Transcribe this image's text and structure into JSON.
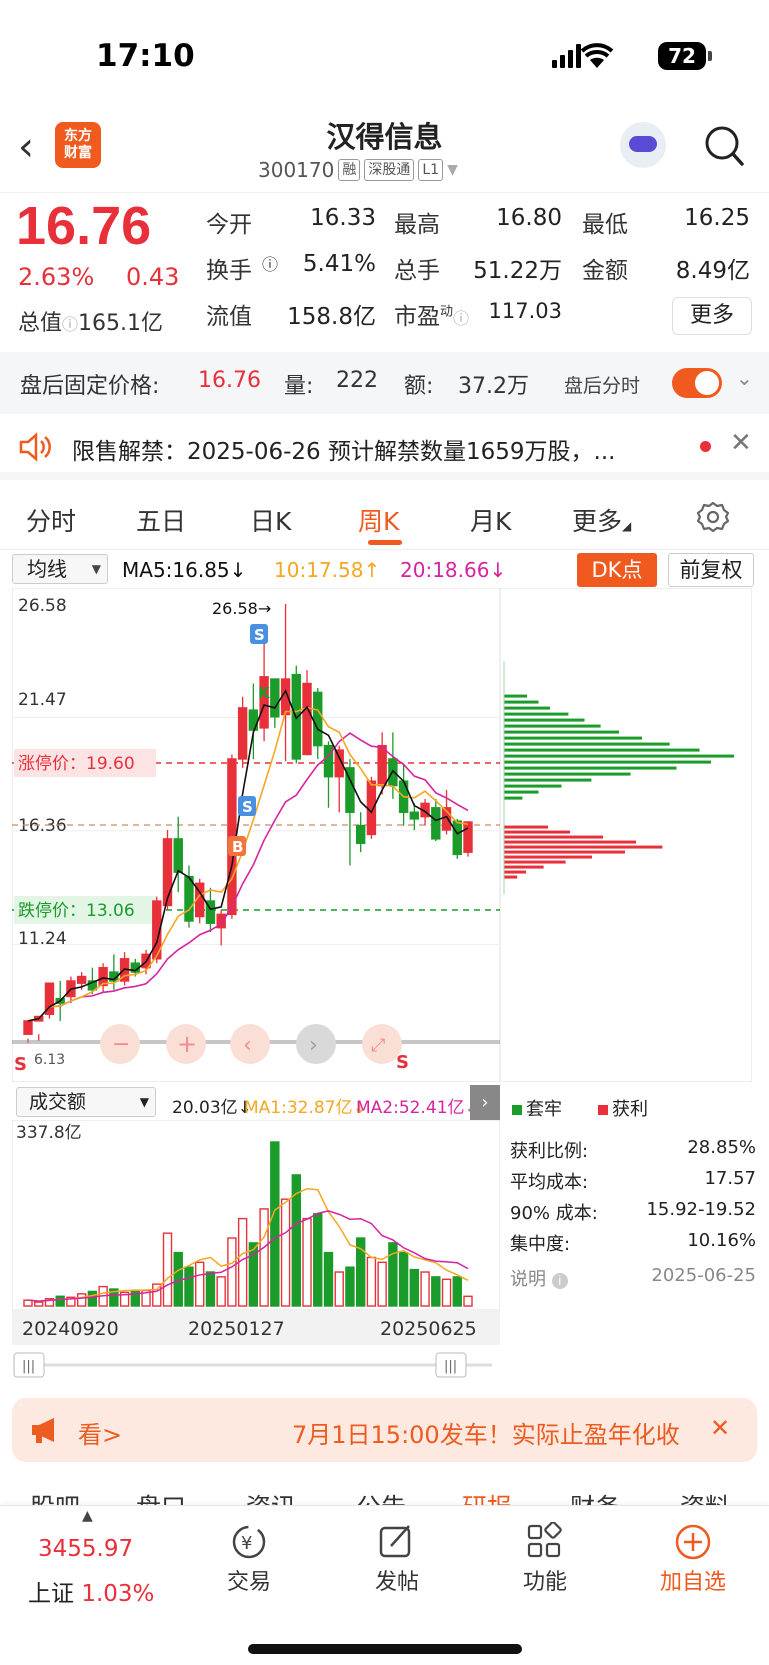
{
  "status_bar": {
    "time": "17:10",
    "battery": "72"
  },
  "header": {
    "name": "汉得信息",
    "code": "300170",
    "tags": [
      "融",
      "深股通",
      "L1"
    ],
    "logo_text": "东方财富"
  },
  "quote": {
    "price": "16.76",
    "pct": "2.63%",
    "change": "0.43",
    "market_cap_label": "总值",
    "market_cap": "165.1亿",
    "open_label": "今开",
    "open": "16.33",
    "high_label": "最高",
    "high": "16.80",
    "low_label": "最低",
    "low": "16.25",
    "turnover_label": "换手",
    "turnover": "5.41%",
    "volume_label": "总手",
    "volume": "51.22万",
    "amount_label": "金额",
    "amount": "8.49亿",
    "float_cap_label": "流值",
    "float_cap": "158.8亿",
    "pe_label": "市盈",
    "pe_sup": "动",
    "pe": "117.03",
    "more_label": "更多"
  },
  "after_hours": {
    "price_label": "盘后固定价格:",
    "price": "16.76",
    "vol_label": "量:",
    "vol": "222",
    "amt_label": "额:",
    "amt": "37.2万",
    "timeshare_label": "盘后分时"
  },
  "notice": {
    "text": "限售解禁：2025-06-26 预计解禁数量1659万股，..."
  },
  "tabs": [
    "分时",
    "五日",
    "日K",
    "周K",
    "月K",
    "更多"
  ],
  "active_tab": "周K",
  "ma_row": {
    "select": "均线",
    "ma5": "MA5:16.85",
    "ma10": "10:17.58",
    "ma20": "20:18.66",
    "dk_label": "DK点",
    "adjust_label": "前复权"
  },
  "kchart_labels": {
    "y_top": "26.58",
    "y_2": "21.47",
    "y_3": "16.36",
    "y_4": "11.24",
    "y_low": "6.13",
    "peak": "26.58",
    "limit_up": "涨停价：19.60",
    "limit_down": "跌停价：13.06"
  },
  "vol_row": {
    "select": "成交额",
    "val": "20.03亿",
    "ma1": "MA1:32.87亿",
    "ma2": "MA2:52.41亿",
    "y_top": "337.8亿"
  },
  "dates": [
    "20240920",
    "20250127",
    "20250625"
  ],
  "chips": {
    "legend_trapped": "套牢",
    "legend_profit": "获利",
    "rows": [
      {
        "label": "获利比例:",
        "value": "28.85%"
      },
      {
        "label": "平均成本:",
        "value": "17.57"
      },
      {
        "label": "90% 成本:",
        "value": "15.92-19.52"
      },
      {
        "label": "集中度:",
        "value": "10.16%"
      }
    ],
    "note_label": "说明",
    "date": "2025-06-25"
  },
  "banner": {
    "left": "看>",
    "text": "7月1日15:00发车！实际止盈年化收"
  },
  "subtabs": [
    "股吧",
    "盘口",
    "资讯",
    "公告",
    "研报",
    "财务",
    "资料"
  ],
  "bottom": {
    "index_value": "3455.97",
    "index_name": "上证",
    "index_pct": "1.03%",
    "items": [
      "交易",
      "发帖",
      "功能",
      "加自选"
    ]
  },
  "colors": {
    "up": "#e8303a",
    "down": "#1a9b2a",
    "accent": "#f05a1e",
    "ma5": "#111111",
    "ma10": "#f5a623",
    "ma20": "#d6249f"
  },
  "chart_data": {
    "type": "candlestick",
    "y_range": [
      6.13,
      26.58
    ],
    "candles": [
      [
        7.2,
        7.8,
        7.0,
        6.8
      ],
      [
        7.8,
        8.0,
        7.2,
        6.9
      ],
      [
        8.1,
        9.5,
        8.5,
        7.9
      ],
      [
        8.8,
        8.6,
        9.6,
        7.8
      ],
      [
        8.9,
        9.6,
        9.8,
        8.6
      ],
      [
        9.5,
        9.8,
        10.0,
        9.2
      ],
      [
        9.6,
        9.2,
        10.2,
        9.0
      ],
      [
        9.4,
        10.2,
        10.4,
        9.1
      ],
      [
        10.0,
        9.6,
        10.8,
        9.2
      ],
      [
        9.6,
        10.6,
        10.9,
        9.4
      ],
      [
        10.4,
        10.0,
        10.6,
        9.8
      ],
      [
        10.2,
        10.8,
        11.0,
        9.9
      ],
      [
        10.6,
        13.2,
        13.4,
        10.4
      ],
      [
        13.0,
        16.0,
        16.4,
        12.8
      ],
      [
        16.0,
        14.5,
        17.0,
        13.6
      ],
      [
        14.3,
        12.3,
        14.8,
        12.0
      ],
      [
        12.5,
        14.0,
        14.2,
        12.2
      ],
      [
        13.2,
        12.2,
        13.8,
        11.8
      ],
      [
        12.0,
        12.6,
        12.8,
        11.2
      ],
      [
        12.6,
        19.6,
        19.8,
        12.4
      ],
      [
        19.6,
        21.9,
        22.4,
        19.2
      ],
      [
        21.8,
        20.9,
        23.0,
        19.6
      ],
      [
        21.0,
        23.3,
        24.8,
        20.4
      ],
      [
        23.2,
        21.5,
        21.8,
        21.0
      ],
      [
        21.6,
        23.2,
        26.58,
        19.5
      ],
      [
        23.4,
        19.6,
        23.8,
        19.4
      ],
      [
        19.8,
        23.0,
        23.6,
        19.8
      ],
      [
        22.6,
        20.2,
        22.8,
        19.6
      ],
      [
        20.2,
        18.8,
        20.4,
        17.4
      ],
      [
        18.8,
        20.0,
        20.2,
        17.2
      ],
      [
        19.2,
        17.2,
        19.6,
        14.8
      ],
      [
        16.6,
        15.8,
        17.2,
        15.4
      ],
      [
        16.2,
        18.6,
        18.8,
        16.0
      ],
      [
        18.4,
        20.2,
        20.8,
        18.0
      ],
      [
        19.6,
        18.4,
        20.8,
        17.8
      ],
      [
        18.6,
        17.2,
        19.4,
        16.6
      ],
      [
        17.2,
        16.9,
        17.6,
        16.4
      ],
      [
        17.0,
        17.6,
        17.8,
        16.6
      ],
      [
        17.4,
        16.0,
        17.8,
        15.9
      ],
      [
        16.4,
        17.4,
        18.2,
        16.2
      ],
      [
        16.8,
        15.3,
        16.9,
        15.1
      ],
      [
        15.4,
        16.76,
        16.8,
        15.2
      ]
    ],
    "volume_max": 337.8,
    "volumes": [
      12,
      8,
      15,
      20,
      18,
      25,
      30,
      40,
      35,
      28,
      30,
      32,
      45,
      150,
      110,
      80,
      90,
      70,
      60,
      140,
      180,
      130,
      200,
      337.8,
      220,
      270,
      180,
      190,
      110,
      70,
      80,
      140,
      100,
      90,
      130,
      110,
      75,
      70,
      60,
      55,
      60,
      20
    ],
    "chip_trapped": [
      0.1,
      0.15,
      0.2,
      0.28,
      0.35,
      0.42,
      0.5,
      0.6,
      0.72,
      0.85,
      1.0,
      0.9,
      0.75,
      0.55,
      0.38,
      0.25,
      0.15,
      0.08
    ],
    "chip_profit": [
      0.2,
      0.3,
      0.45,
      0.6,
      0.72,
      0.55,
      0.4,
      0.28,
      0.18,
      0.1,
      0.06
    ]
  }
}
